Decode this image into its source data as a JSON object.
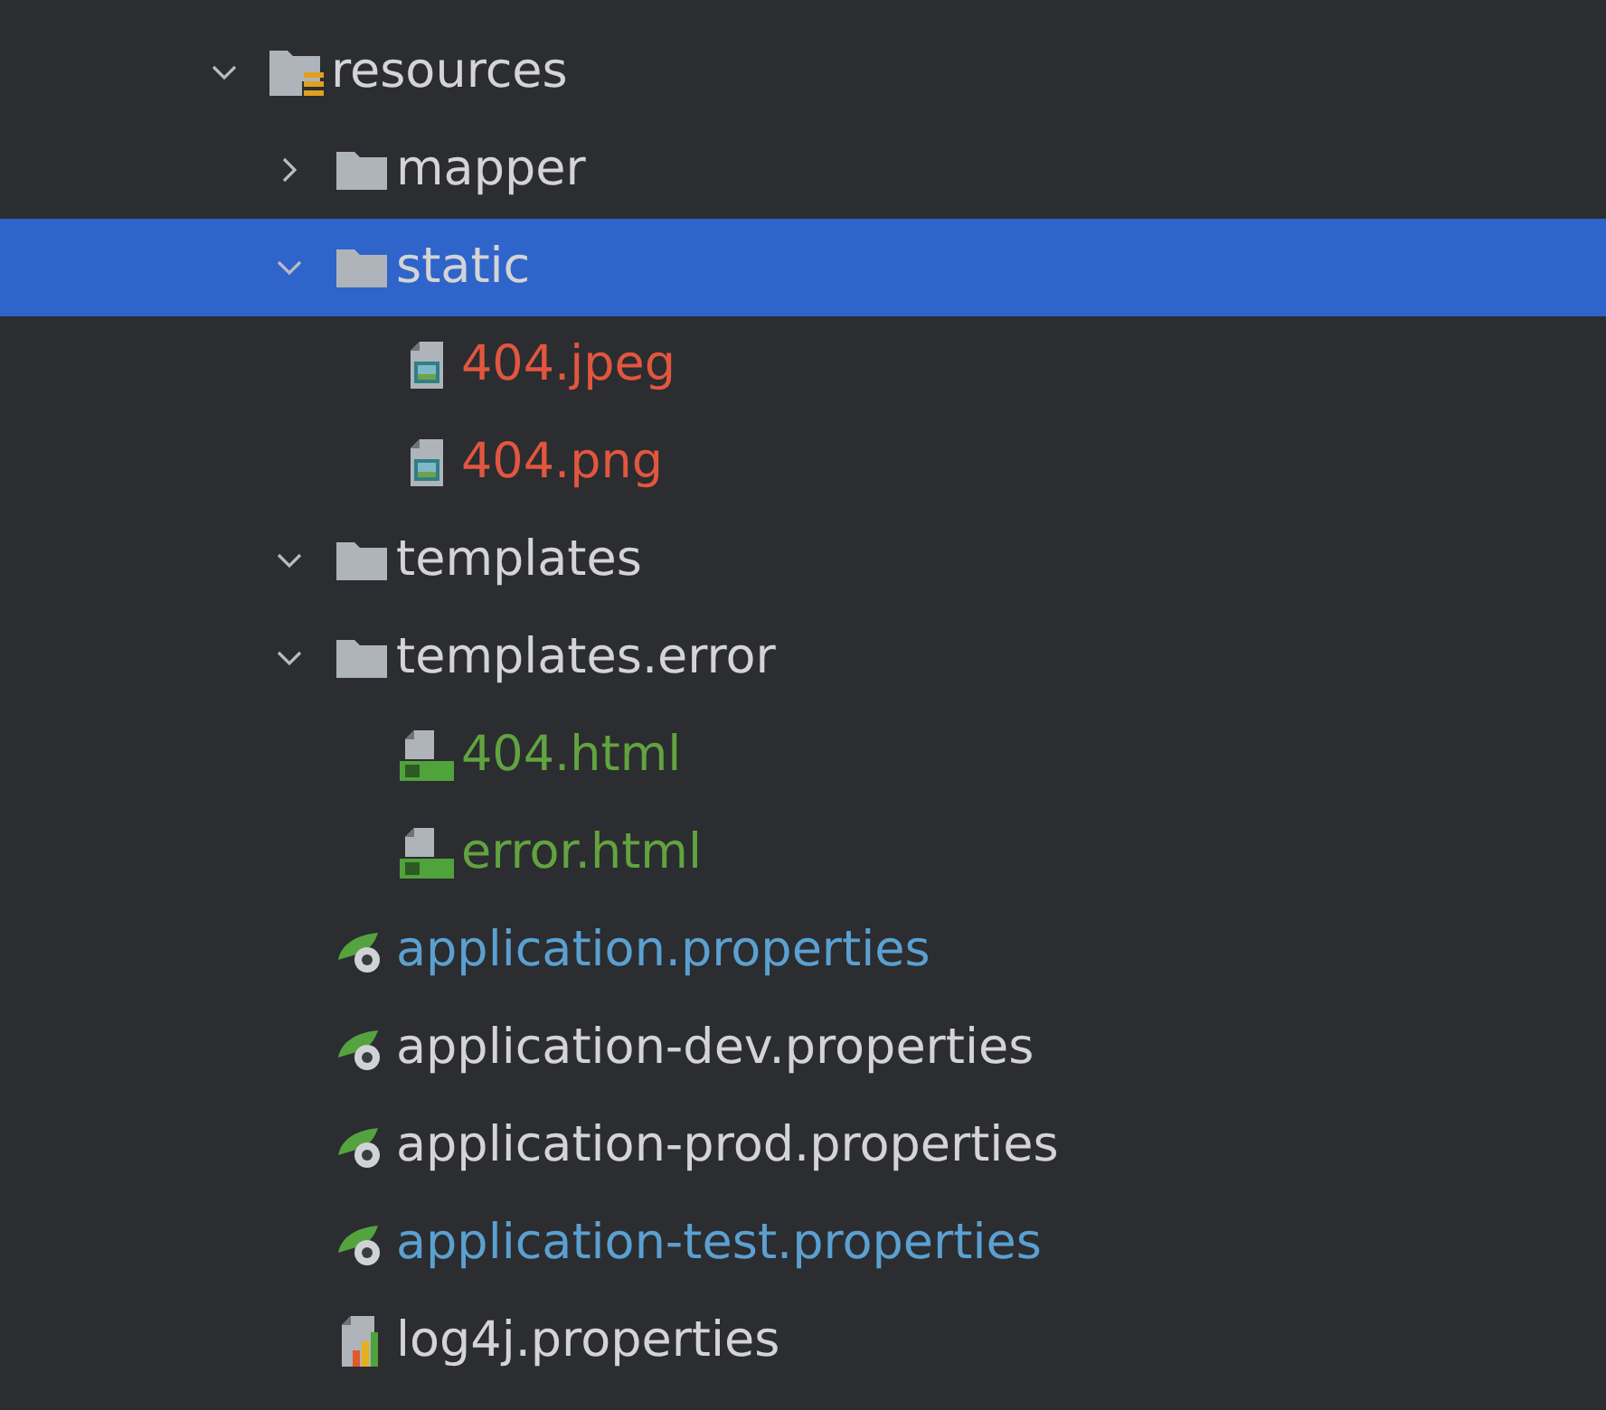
{
  "tree": [
    {
      "kind": "resource-folder",
      "name": "resources",
      "color": "#d4d4d4",
      "expanded": true,
      "selected": false,
      "children": [
        {
          "kind": "folder",
          "name": "mapper",
          "color": "#d4d4d4",
          "expanded": false,
          "selected": false
        },
        {
          "kind": "folder",
          "name": "static",
          "color": "#d4d4d4",
          "expanded": true,
          "selected": true,
          "children": [
            {
              "kind": "image",
              "name": "404.jpeg",
              "color": "#e2563f",
              "selected": false
            },
            {
              "kind": "image",
              "name": "404.png",
              "color": "#e2563f",
              "selected": false
            }
          ]
        },
        {
          "kind": "folder",
          "name": "templates",
          "color": "#d4d4d4",
          "expanded": true,
          "selected": false
        },
        {
          "kind": "folder",
          "name": "templates.error",
          "color": "#d4d4d4",
          "expanded": true,
          "selected": false,
          "children": [
            {
              "kind": "html",
              "name": "404.html",
              "color": "#62a340",
              "selected": false
            },
            {
              "kind": "html",
              "name": "error.html",
              "color": "#62a340",
              "selected": false
            }
          ]
        },
        {
          "kind": "spring",
          "name": "application.properties",
          "color": "#5ba0d0",
          "selected": false
        },
        {
          "kind": "spring",
          "name": "application-dev.properties",
          "color": "#d4d4d4",
          "selected": false
        },
        {
          "kind": "spring",
          "name": "application-prod.properties",
          "color": "#d4d4d4",
          "selected": false
        },
        {
          "kind": "spring",
          "name": "application-test.properties",
          "color": "#5ba0d0",
          "selected": false
        },
        {
          "kind": "log",
          "name": "log4j.properties",
          "color": "#d4d4d4",
          "selected": false
        }
      ]
    }
  ]
}
